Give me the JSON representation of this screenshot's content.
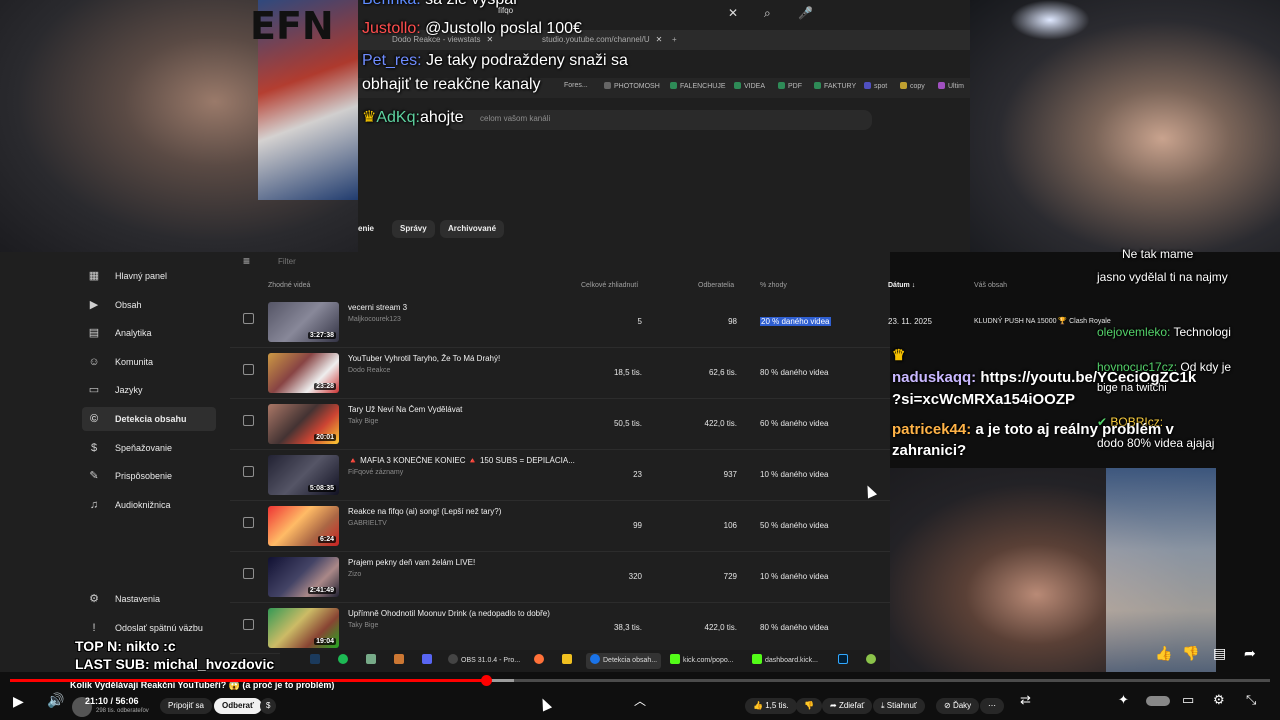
{
  "colors": {
    "accent_red": "#ff0000",
    "highlight_blue": "#2f5fd1",
    "sidebar_bg": "#1f1f1f"
  },
  "top_browser": {
    "search_text": "fifqo",
    "tabs": [
      {
        "label": "Dodo Reakce - viewstats"
      },
      {
        "label": "studio.youtube.com/channel/U"
      }
    ],
    "bookmarks": [
      "Fores...",
      "PHOTOMOSH",
      "FALENCHUJE",
      "VIDEA",
      "PDF",
      "FAKTURY",
      "spot",
      "copy",
      "Ultim"
    ],
    "search_bar_placeholder": "celom vašom kanáli",
    "chips": [
      "enie",
      "Správy",
      "Archivované"
    ]
  },
  "chat_top": [
    {
      "user": "Berinka:",
      "msg": "sa zle vyspal",
      "color": "#5f8cff"
    },
    {
      "user": "Justollo:",
      "msg": "@Justollo poslal 100€",
      "color": "#ff4d4d"
    },
    {
      "user": "Pet_res:",
      "msg": "Je taky podrаždeny snaži sa",
      "color": "#6f8cff"
    },
    {
      "user": "",
      "msg": "obhajiť te reakčne kanaly",
      "color": "#fff"
    },
    {
      "user": "AdKq:",
      "msg": "ahojte",
      "color": "#5ed2a0"
    }
  ],
  "sidebar": {
    "items": [
      {
        "label": "Hlavný panel",
        "icon": "dashboard-icon"
      },
      {
        "label": "Obsah",
        "icon": "content-icon"
      },
      {
        "label": "Analytika",
        "icon": "analytics-icon"
      },
      {
        "label": "Komunita",
        "icon": "community-icon"
      },
      {
        "label": "Jazyky",
        "icon": "languages-icon"
      },
      {
        "label": "Detekcia obsahu",
        "icon": "copyright-icon"
      },
      {
        "label": "Speňažovanie",
        "icon": "monetization-icon"
      },
      {
        "label": "Prispôsobenie",
        "icon": "customization-icon"
      },
      {
        "label": "Audioknižnica",
        "icon": "audio-library-icon"
      },
      {
        "label": "Nastavenia",
        "icon": "settings-icon"
      },
      {
        "label": "Odoslať spätnú väzbu",
        "icon": "feedback-icon"
      }
    ]
  },
  "table": {
    "filter_placeholder": "Filter",
    "headers": {
      "video": "Zhodné videá",
      "views": "Celkové zhliadnutí",
      "subs": "Odberatelia",
      "match": "% zhody",
      "date": "Dátum",
      "content": "Váš obsah"
    },
    "rows": [
      {
        "title": "vecerni stream 3",
        "channel": "Maljkocourek123",
        "duration": "3:27:38",
        "views": "5",
        "subs": "98",
        "match": "20 % daného videa",
        "date": "23. 11. 2025",
        "content": "KLUDNÝ PUSH NA 15000 🏆 Clash Royale"
      },
      {
        "title": "YouTuber Vyhrotil Taryho, Že To Má Drahý!",
        "channel": "Dodo Reakce",
        "duration": "23:28",
        "views": "18,5 tis.",
        "subs": "62,6 tis.",
        "match": "80 % daného videa",
        "date": "",
        "content": ""
      },
      {
        "title": "Tary Už Neví Na Čem Vydělávat",
        "channel": "Taky Bige",
        "duration": "20:01",
        "views": "50,5 tis.",
        "subs": "422,0 tis.",
        "match": "60 % daného videa",
        "date": "",
        "content": ""
      },
      {
        "title": "🔺 MAFIA 3 KONEČNE KONIEC 🔺 150 SUBS = DEPILÁCIA...",
        "channel": "FiFqové záznamy",
        "duration": "5:08:35",
        "views": "23",
        "subs": "937",
        "match": "10 % daného videa",
        "date": "",
        "content": ""
      },
      {
        "title": "Reakce na fifqo (ai) song! (Lepší než tary?)",
        "channel": "GABRIELTV",
        "duration": "6:24",
        "views": "99",
        "subs": "106",
        "match": "50 % daného videa",
        "date": "",
        "content": ""
      },
      {
        "title": "Prajem pekny deň vam želám LIVE!",
        "channel": "Zizo",
        "duration": "2:41:49",
        "views": "320",
        "subs": "729",
        "match": "10 % daného videa",
        "date": "",
        "content": ""
      },
      {
        "title": "Upřímně Ohodnotil Moonuv Drink (a nedopadlo to dobře)",
        "channel": "Taky Bige",
        "duration": "19:04",
        "views": "38,3 tis.",
        "subs": "422,0 tis.",
        "match": "80 % daného videa",
        "date": "",
        "content": ""
      }
    ]
  },
  "chat_right": [
    {
      "user": "",
      "msg": "Ne tak mame",
      "color": "#fff"
    },
    {
      "user": "",
      "msg": "jasno vydělal ti na najmy",
      "color": "#fff"
    },
    {
      "user": "olejovemleko:",
      "msg": "Technologi",
      "color": "#54d26a"
    },
    {
      "user": "hovnocuc17cz:",
      "msg": "Od kdy je",
      "color": "#54d26a"
    },
    {
      "user": "",
      "msg": "bige na twitchi",
      "color": "#fff"
    },
    {
      "user": "BOBRIcz:",
      "msg": "",
      "color": "#ffd23f"
    },
    {
      "user": "",
      "msg": "dodo 80% videa ajajaj",
      "color": "#fff"
    }
  ],
  "chat_mid": [
    {
      "user": "naduskaqq:",
      "msg": "https://youtu.be/YCeciOgZC1k",
      "color": "#c9b8ff"
    },
    {
      "user": "",
      "msg": "?si=xcWcMRXa154iOOZP",
      "color": "#fff"
    },
    {
      "user": "patricek44:",
      "msg": "a je toto aj reálny problém v",
      "color": "#ffb347"
    },
    {
      "user": "",
      "msg": "zahranici?",
      "color": "#fff"
    }
  ],
  "overlay": {
    "top_n": "TOP N: nikto :c",
    "last_sub": "LAST SUB: michal_hvozdovic"
  },
  "taskbar": [
    {
      "label": "OBS 31.0.4 - Pro...",
      "color": "#444"
    },
    {
      "label": "Detekcia obsah...",
      "color": "#1a73e8"
    },
    {
      "label": "kick.com/popo...",
      "color": "#53fc18"
    },
    {
      "label": "dashboard.kick...",
      "color": "#53fc18"
    }
  ],
  "player": {
    "title": "Kolik Vydělávají Reakční YouTubeři? 😱 (a proč je to problém)",
    "time": "21:10 / 56:06",
    "channel_subs": "298 tis. odberateľov",
    "join": "Pripojiť sa",
    "subscribe": "Odberať",
    "likes": "1,5 tis.",
    "share": "Zdieľať",
    "download": "Stiahnuť",
    "thanks": "Ďaky",
    "progress": 0.378,
    "buffer": 0.4
  }
}
